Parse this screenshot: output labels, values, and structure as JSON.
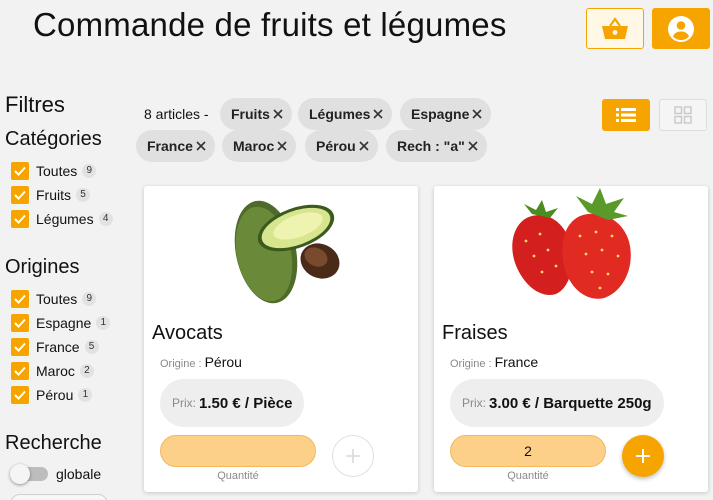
{
  "header": {
    "title": "Commande de fruits et légumes",
    "basket_icon": "basket-icon",
    "account_icon": "account-circle-icon"
  },
  "colors": {
    "accent": "#f6a400",
    "accent_light": "#fdd08a",
    "chip": "#e0e0e0"
  },
  "sidebar": {
    "filters_title": "Filtres",
    "categories": {
      "title": "Catégories",
      "items": [
        {
          "label": "Toutes",
          "count": "9",
          "checked": true
        },
        {
          "label": "Fruits",
          "count": "5",
          "checked": true
        },
        {
          "label": "Légumes",
          "count": "4",
          "checked": true
        }
      ]
    },
    "origins": {
      "title": "Origines",
      "items": [
        {
          "label": "Toutes",
          "count": "9",
          "checked": true
        },
        {
          "label": "Espagne",
          "count": "1",
          "checked": true
        },
        {
          "label": "France",
          "count": "5",
          "checked": true
        },
        {
          "label": "Maroc",
          "count": "2",
          "checked": true
        },
        {
          "label": "Pérou",
          "count": "1",
          "checked": true
        }
      ]
    },
    "search": {
      "title": "Recherche",
      "toggle_label": "globale",
      "toggle_on": false
    }
  },
  "results": {
    "count_label": "8 articles -",
    "chips": [
      "Fruits",
      "Légumes",
      "Espagne",
      "France",
      "Maroc",
      "Pérou",
      "Rech : \"a\""
    ],
    "view_list_icon": "list-view-icon",
    "view_grid_icon": "grid-view-icon"
  },
  "products": [
    {
      "name": "Avocats",
      "origin_label": "Origine :",
      "origin": "Pérou",
      "price_label": "Prix:",
      "price": "1.50 € / Pièce",
      "quantity": "",
      "quantity_label": "Quantité",
      "image_icon": "avocado-image"
    },
    {
      "name": "Fraises",
      "origin_label": "Origine :",
      "origin": "France",
      "price_label": "Prix:",
      "price": "3.00 € / Barquette 250g",
      "quantity": "2",
      "quantity_label": "Quantité",
      "image_icon": "strawberry-image"
    }
  ]
}
